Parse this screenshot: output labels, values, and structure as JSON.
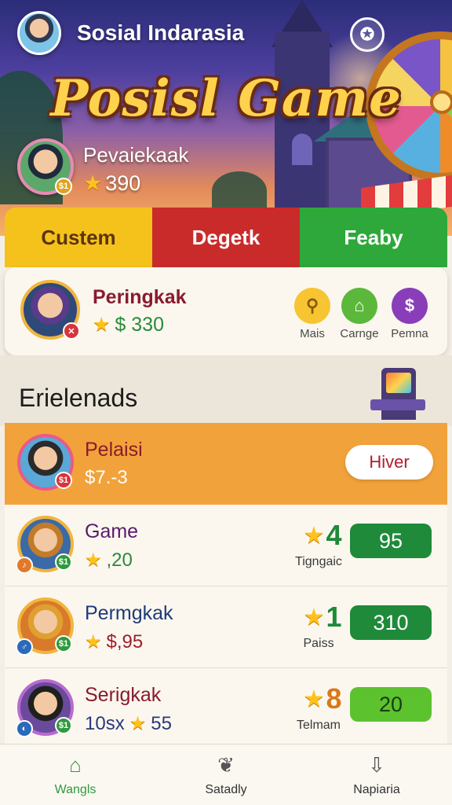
{
  "header": {
    "app_title": "Sosial Indarasia",
    "game_title": "Posisl Game",
    "player_name": "Pevaiekaak",
    "player_score": "390"
  },
  "tabs": [
    {
      "label": "Custem"
    },
    {
      "label": "Degetk"
    },
    {
      "label": "Feaby"
    }
  ],
  "profile": {
    "name": "Peringkak",
    "score": "$ 330",
    "actions": [
      {
        "label": "Mais",
        "icon": "search-icon"
      },
      {
        "label": "Carnge",
        "icon": "shop-icon"
      },
      {
        "label": "Pemna",
        "icon": "dollar-icon"
      }
    ]
  },
  "section": {
    "title": "Erielenads"
  },
  "highlight_row": {
    "name": "Pelaisi",
    "value": "$7.-3",
    "button": "Hiver"
  },
  "leaderboard": [
    {
      "name": "Game",
      "sub": ",20",
      "rank": "4",
      "rank_label": "Tigngaic",
      "score": "95"
    },
    {
      "name": "Permgkak",
      "sub": "$,95",
      "rank": "1",
      "rank_label": "Paiss",
      "score": "310"
    },
    {
      "name": "Serigkak",
      "sub_prefix": "10sx",
      "sub": "55",
      "rank": "8",
      "rank_label": "Telmam",
      "score": "20"
    }
  ],
  "bottom_nav": [
    {
      "label": "Wangls",
      "icon": "home-icon"
    },
    {
      "label": "Satadly",
      "icon": "leaf-icon"
    },
    {
      "label": "Napiaria",
      "icon": "download-icon"
    }
  ],
  "colors": {
    "tab_yellow": "#f5c21c",
    "tab_red": "#c92b2b",
    "tab_green": "#2ea83a",
    "highlight_orange": "#f2a23a",
    "score_green": "#1e8a3a",
    "score_light_green": "#5cc22e"
  }
}
